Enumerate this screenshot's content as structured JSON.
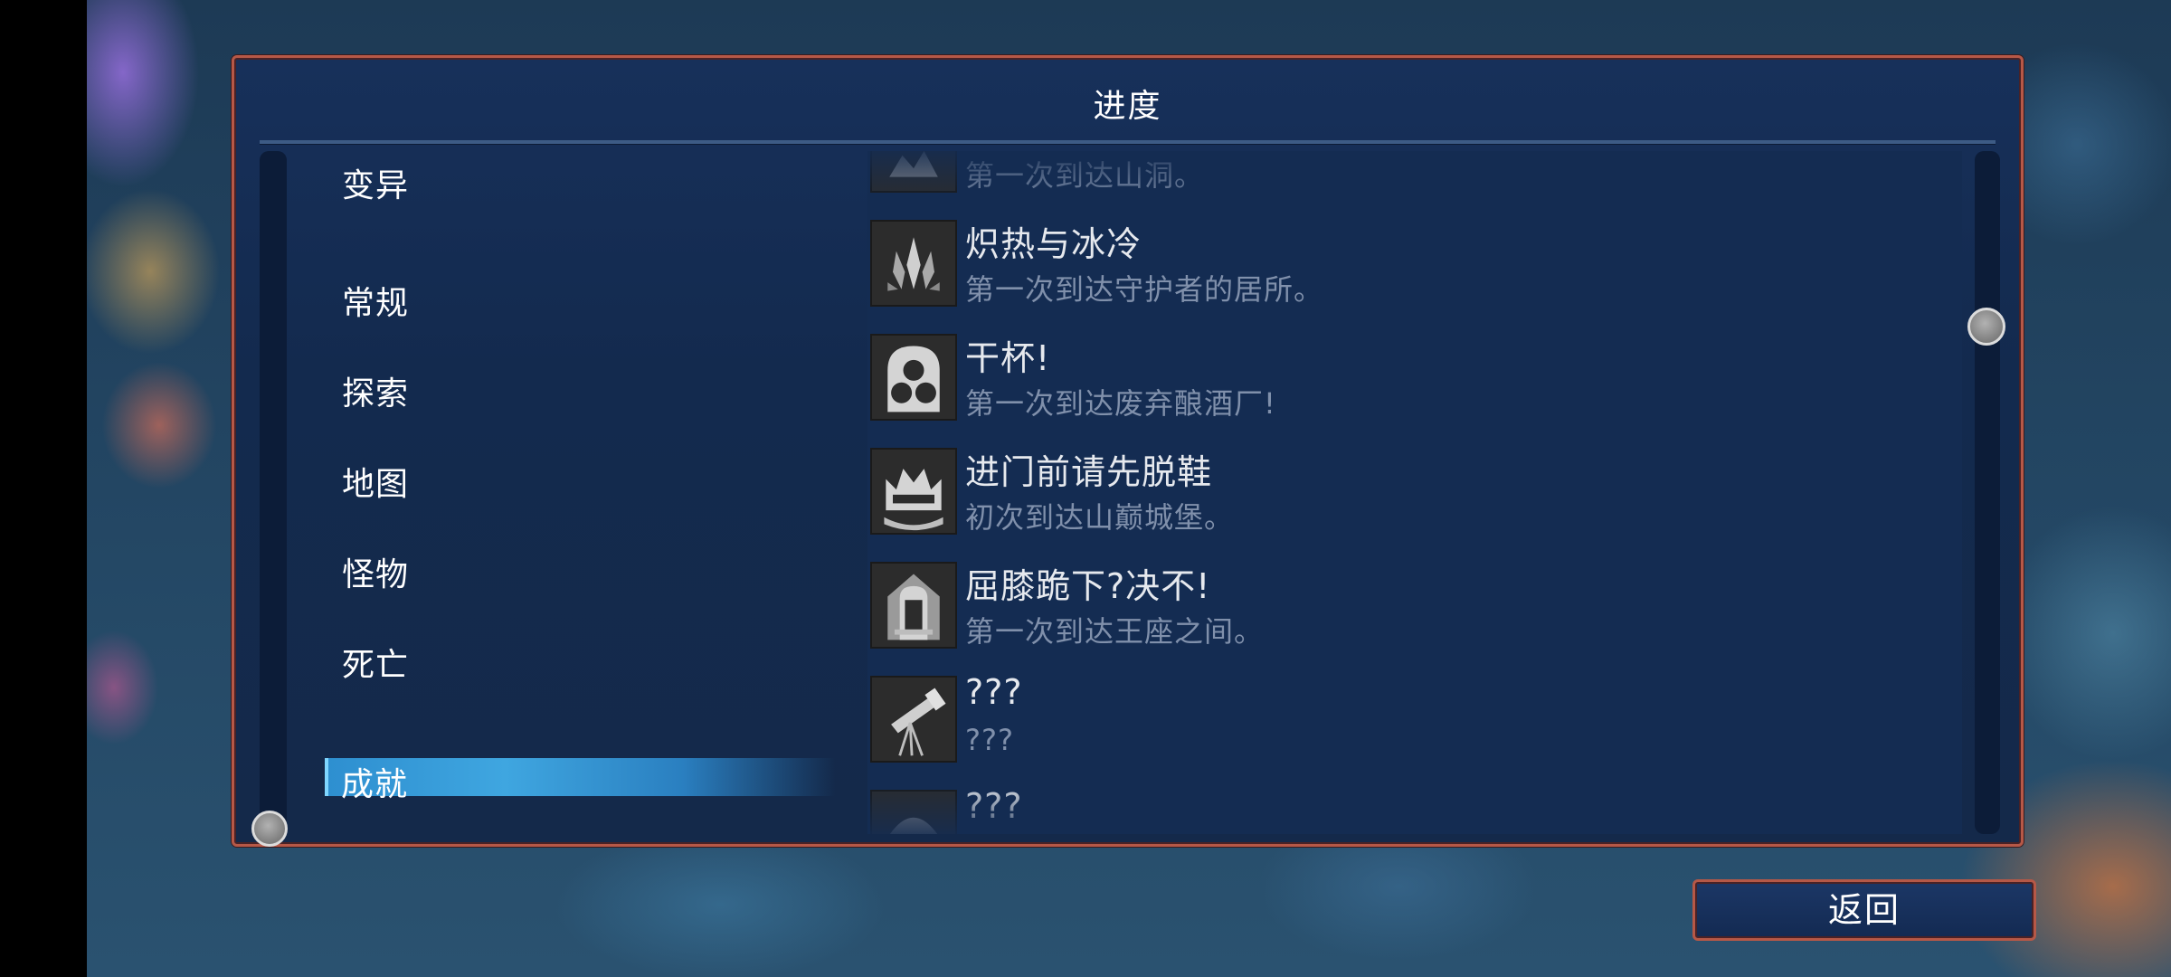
{
  "panel": {
    "title": "进度"
  },
  "categories": [
    {
      "label": "变异",
      "selected": false
    },
    {
      "label": "常规",
      "selected": false
    },
    {
      "label": "探索",
      "selected": false
    },
    {
      "label": "地图",
      "selected": false
    },
    {
      "label": "怪物",
      "selected": false
    },
    {
      "label": "死亡",
      "selected": false
    },
    {
      "label": "成就",
      "selected": true
    }
  ],
  "achievements": [
    {
      "title": "",
      "desc": "第一次到达山洞。",
      "icon": "cave-icon"
    },
    {
      "title": "炽热与冰冷",
      "desc": "第一次到达守护者的居所。",
      "icon": "crystal-icon"
    },
    {
      "title": "干杯!",
      "desc": "第一次到达废弃酿酒厂!",
      "icon": "barrels-icon"
    },
    {
      "title": "进门前请先脱鞋",
      "desc": "初次到达山巅城堡。",
      "icon": "castle-icon"
    },
    {
      "title": "屈膝跪下?决不!",
      "desc": "第一次到达王座之间。",
      "icon": "throne-icon"
    },
    {
      "title": "???",
      "desc": "???",
      "icon": "telescope-icon"
    },
    {
      "title": "???",
      "desc": "",
      "icon": "locked-icon"
    }
  ],
  "back_button": {
    "label": "返回"
  }
}
